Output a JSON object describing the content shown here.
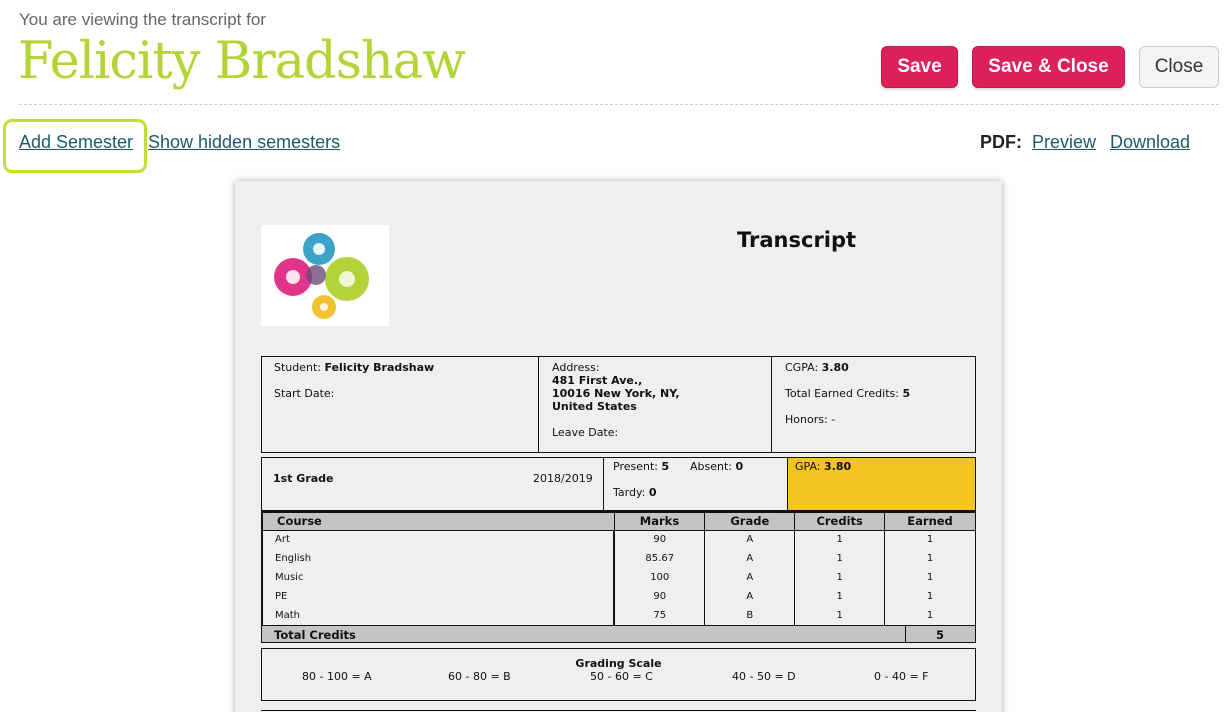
{
  "header": {
    "viewing_text": "You are viewing the transcript for",
    "student_name": "Felicity Bradshaw",
    "save_label": "Save",
    "save_close_label": "Save & Close",
    "close_label": "Close"
  },
  "toolbar": {
    "add_semester": "Add Semester",
    "show_hidden": "Show hidden semesters",
    "pdf_label": "PDF:",
    "preview": "Preview",
    "download": "Download"
  },
  "colors": {
    "accent_green": "#b4d336",
    "primary_button": "#dd1f5c",
    "link": "#1c5a6b",
    "gpa_highlight": "#f4c421"
  },
  "transcript": {
    "title": "Transcript",
    "student_label": "Student:",
    "student_name": "Felicity Bradshaw",
    "start_date_label": "Start Date:",
    "address_label": "Address:",
    "address_line1": "481 First Ave.,",
    "address_line2": "10016 New York, NY,",
    "address_line3": "United States",
    "leave_date_label": "Leave Date:",
    "cgpa_label": "CGPA:",
    "cgpa": "3.80",
    "total_credits_label": "Total Earned Credits:",
    "total_credits": "5",
    "honors_label": "Honors:",
    "honors": "-",
    "semester": {
      "name": "1st Grade",
      "year": "2018/2019",
      "present_label": "Present:",
      "present": "5",
      "absent_label": "Absent:",
      "absent": "0",
      "tardy_label": "Tardy:",
      "tardy": "0",
      "gpa_label": "GPA:",
      "gpa": "3.80"
    },
    "columns": [
      "Course",
      "Marks",
      "Grade",
      "Credits",
      "Earned"
    ],
    "courses": [
      {
        "course": "Art",
        "marks": "90",
        "grade": "A",
        "credits": "1",
        "earned": "1"
      },
      {
        "course": "English",
        "marks": "85.67",
        "grade": "A",
        "credits": "1",
        "earned": "1"
      },
      {
        "course": "Music",
        "marks": "100",
        "grade": "A",
        "credits": "1",
        "earned": "1"
      },
      {
        "course": "PE",
        "marks": "90",
        "grade": "A",
        "credits": "1",
        "earned": "1"
      },
      {
        "course": "Math",
        "marks": "75",
        "grade": "B",
        "credits": "1",
        "earned": "1"
      }
    ],
    "total_credits_row_label": "Total Credits",
    "total_credits_row_value": "5",
    "grading_title": "Grading Scale",
    "grading": [
      "80 - 100 = A",
      "60 - 80 = B",
      "50 - 60 = C",
      "40 - 50 = D",
      "0 - 40 = F"
    ]
  }
}
